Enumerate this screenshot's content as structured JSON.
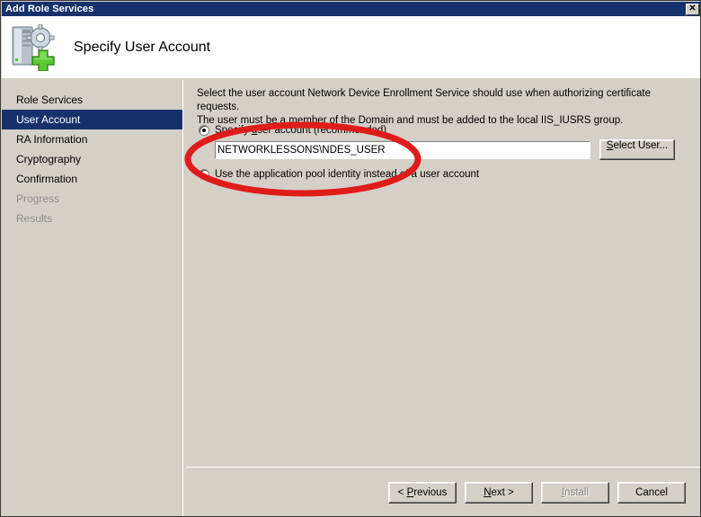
{
  "window": {
    "title": "Add Role Services",
    "close_label": "✕"
  },
  "header": {
    "title": "Specify User Account",
    "icon": "server-add-icon"
  },
  "sidebar": {
    "items": [
      {
        "label": "Role Services",
        "state": "normal"
      },
      {
        "label": "User Account",
        "state": "selected"
      },
      {
        "label": "RA Information",
        "state": "normal"
      },
      {
        "label": "Cryptography",
        "state": "normal"
      },
      {
        "label": "Confirmation",
        "state": "normal"
      },
      {
        "label": "Progress",
        "state": "disabled"
      },
      {
        "label": "Results",
        "state": "disabled"
      }
    ]
  },
  "main": {
    "description_line1": "Select the user account Network Device Enrollment Service should use when authorizing certificate requests.",
    "description_line2": "The user must be a member of the Domain and must be added to the local IIS_IUSRS group.",
    "option_specify_pre": "Specify ",
    "option_specify_acc": "u",
    "option_specify_post": "ser account (recommended)",
    "option_apppool": "Use the application pool identity instead of a user account",
    "account_value": "NETWORKLESSONS\\NDES_USER",
    "account_placeholder": "",
    "select_user_pre": "",
    "select_user_acc": "S",
    "select_user_post": "elect User..."
  },
  "footer": {
    "previous_pre": "< ",
    "previous_acc": "P",
    "previous_post": "revious",
    "next_pre": "",
    "next_acc": "N",
    "next_post": "ext >",
    "install_pre": "",
    "install_acc": "I",
    "install_post": "nstall",
    "cancel_label": "Cancel"
  },
  "annotation": {
    "type": "red-ellipse-highlight",
    "color": "#e01b1b"
  }
}
